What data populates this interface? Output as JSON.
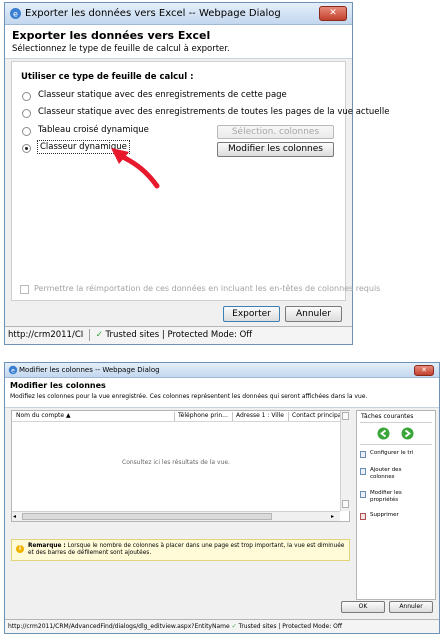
{
  "dialog1": {
    "window_title": "Exporter les données vers Excel -- Webpage Dialog",
    "heading": "Exporter les données vers Excel",
    "subheading": "Sélectionnez le type de feuille de calcul à exporter.",
    "section_label": "Utiliser ce type de feuille de calcul :",
    "options": [
      "Classeur statique avec des enregistrements de cette page",
      "Classeur statique avec des enregistrements de toutes les pages de la vue actuelle",
      "Tableau croisé dynamique",
      "Classeur dynamique"
    ],
    "selected_option": "Classeur dynamique",
    "select_columns_label": "Sélection. colonnes",
    "modify_columns_label": "Modifier les colonnes",
    "reimport_checkbox_label": "Permettre la réimportation de ces données en incluant les en-têtes de colonnes requis",
    "export_label": "Exporter",
    "cancel_label": "Annuler",
    "status_url": "http://crm2011/CI",
    "status_zone": "Trusted sites | Protected Mode: Off",
    "close_glyph": "✕"
  },
  "dialog2": {
    "window_title": "Modifier les colonnes -- Webpage Dialog",
    "heading": "Modifier les colonnes",
    "subheading": "Modifiez les colonnes pour la vue enregistrée. Ces colonnes représentent les données qui seront affichées dans la vue.",
    "columns": [
      "Nom du compte ▲",
      "Téléphone prin...",
      "Adresse 1 : Ville",
      "Contact principal"
    ],
    "grid_empty_text": "Consultez ici les résultats de la vue.",
    "tasks_title": "Tâches courantes",
    "tasks": [
      "Configurer le tri",
      "Ajouter des colonnes",
      "Modifier les propriétés",
      "Supprimer"
    ],
    "note_label": "Remarque :",
    "note_text": "Lorsque le nombre de colonnes à placer dans une page est trop important, la vue est diminuée et des barres de défilement sont ajoutées.",
    "ok_label": "OK",
    "cancel_label": "Annuler",
    "status_url": "http://crm2011/CRM/AdvancedFind/dialogs/dlg_editview.aspx?EntityName",
    "status_zone": "Trusted sites | Protected Mode: Off",
    "close_glyph": "✕"
  },
  "colors": {
    "arrow": "#e8192c",
    "nav_green": "#3aa63a",
    "note_yellow": "#fffbd8"
  }
}
